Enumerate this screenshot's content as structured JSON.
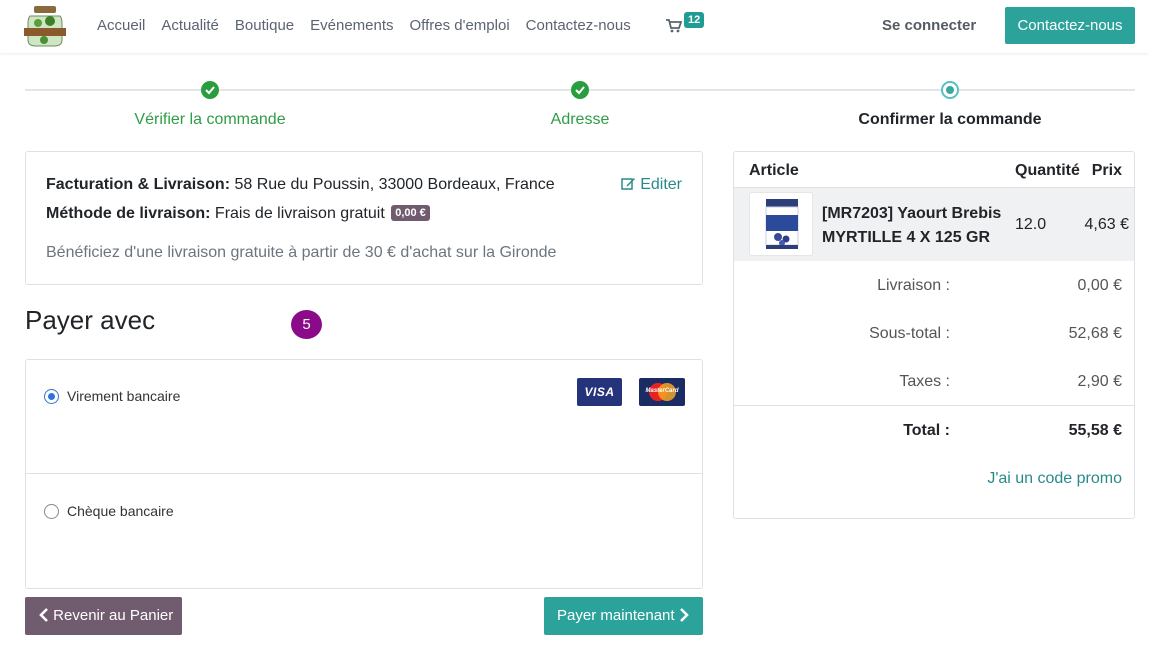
{
  "header": {
    "nav": [
      "Accueil",
      "Actualité",
      "Boutique",
      "Evénements",
      "Offres d'emploi",
      "Contactez-nous"
    ],
    "cart_count": "12",
    "signin_label": "Se connecter",
    "contact_button": "Contactez-nous"
  },
  "steps": [
    {
      "label": "Vérifier la commande",
      "status": "done"
    },
    {
      "label": "Adresse",
      "status": "done"
    },
    {
      "label": "Confirmer la commande",
      "status": "current"
    }
  ],
  "address": {
    "billing_label": "Facturation & Livraison:",
    "billing_value": "58 Rue du Poussin, 33000 Bordeaux, France",
    "shipping_label": "Méthode de livraison:",
    "shipping_value": "Frais de livraison gratuit",
    "shipping_price": "0,00 €",
    "edit_label": "Editer",
    "free_shipping_note": "Bénéficiez d'une livraison gratuite à partir de 30 € d'achat sur la Gironde"
  },
  "payment": {
    "title": "Payer avec",
    "step_marker": "5",
    "options": [
      {
        "label": "Virement bancaire",
        "selected": true
      },
      {
        "label": "Chèque bancaire",
        "selected": false
      }
    ],
    "cards": [
      "VISA",
      "MasterCard"
    ]
  },
  "actions": {
    "back_label": "Revenir au Panier",
    "pay_label": "Payer maintenant"
  },
  "summary": {
    "headers": {
      "article": "Article",
      "quantity": "Quantité",
      "price": "Prix"
    },
    "product": {
      "name": "[MR7203] Yaourt Brebis MYRTILLE 4 X 125 GR",
      "quantity": "12.0",
      "price": "4,63 €"
    },
    "delivery_label": "Livraison :",
    "delivery_value": "0,00 €",
    "subtotal_label": "Sous-total :",
    "subtotal_value": "52,68 €",
    "taxes_label": "Taxes :",
    "taxes_value": "2,90 €",
    "total_label": "Total :",
    "total_value": "55,58 €",
    "promo_link": "J'ai un code promo"
  },
  "colors": {
    "accent": "#2ba39a",
    "success": "#2a9d3f",
    "secondary": "#715b6f",
    "link": "#2a8a8a",
    "marker": "#8a0a8a"
  }
}
